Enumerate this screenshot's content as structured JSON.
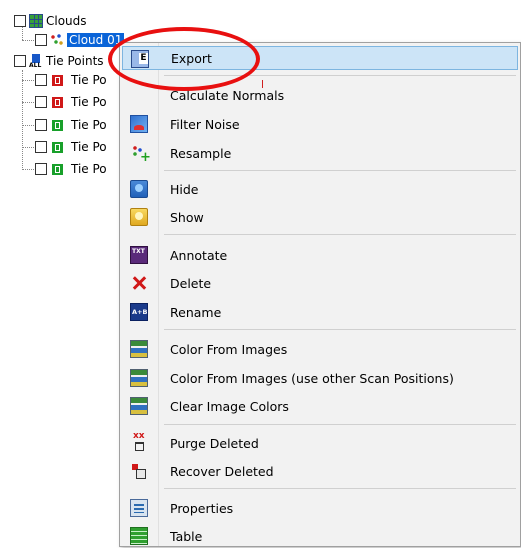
{
  "tree": {
    "root_label": "Clouds",
    "cloud_label": "Cloud 01",
    "tie_points_label": "Tie Points",
    "tie_point_items": [
      {
        "label": "Tie Po",
        "status": "red"
      },
      {
        "label": "Tie Po",
        "status": "red"
      },
      {
        "label": "Tie Po",
        "status": "green"
      },
      {
        "label": "Tie Po",
        "status": "green"
      },
      {
        "label": "Tie Po",
        "status": "green"
      }
    ],
    "all_icon_text": "ALL"
  },
  "context_menu": {
    "items": [
      {
        "label": "Export",
        "icon": "export-icon",
        "highlighted": true
      },
      {
        "label": "Calculate Normals",
        "icon": "none"
      },
      {
        "label": "Filter Noise",
        "icon": "filter-noise-icon"
      },
      {
        "label": "Resample",
        "icon": "resample-icon"
      },
      {
        "label": "Hide",
        "icon": "hide-icon"
      },
      {
        "label": "Show",
        "icon": "show-icon"
      },
      {
        "label": "Annotate",
        "icon": "annotate-icon"
      },
      {
        "label": "Delete",
        "icon": "delete-icon"
      },
      {
        "label": "Rename",
        "icon": "rename-icon"
      },
      {
        "label": "Color From Images",
        "icon": "color-from-images-icon"
      },
      {
        "label": "Color From Images (use other Scan Positions)",
        "icon": "color-from-images-icon"
      },
      {
        "label": "Clear Image Colors",
        "icon": "clear-image-colors-icon"
      },
      {
        "label": "Purge Deleted",
        "icon": "purge-deleted-icon"
      },
      {
        "label": "Recover Deleted",
        "icon": "recover-deleted-icon"
      },
      {
        "label": "Properties",
        "icon": "properties-icon"
      },
      {
        "label": "Table",
        "icon": "table-icon"
      }
    ]
  },
  "colors": {
    "highlight_ring": "#e81010",
    "menu_hover": "#cce4f7",
    "selection": "#0a64d8"
  }
}
